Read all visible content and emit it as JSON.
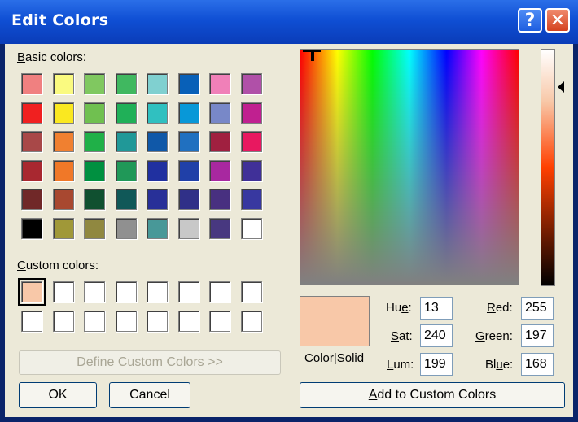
{
  "window": {
    "title": "Edit Colors"
  },
  "basic": {
    "label": "Basic colors:",
    "colors": [
      "#f08080",
      "#fafa80",
      "#80c860",
      "#40b860",
      "#80d0d0",
      "#0860b8",
      "#f080b8",
      "#b050a8",
      "#f02020",
      "#fae820",
      "#70c050",
      "#20b058",
      "#30c0c0",
      "#0898d8",
      "#7888c8",
      "#c02090",
      "#a84848",
      "#f08030",
      "#20b048",
      "#209898",
      "#1058a8",
      "#2070c0",
      "#a02040",
      "#e81860",
      "#a82830",
      "#f07828",
      "#009040",
      "#209858",
      "#2030a0",
      "#2040a8",
      "#a828a0",
      "#403098",
      "#702828",
      "#a84830",
      "#105030",
      "#105858",
      "#283098",
      "#303088",
      "#483080",
      "#3838a0",
      "#000000",
      "#a09838",
      "#908840",
      "#909090",
      "#489898",
      "#c8c8c8",
      "#483880",
      "#ffffff"
    ]
  },
  "custom": {
    "label": "Custom colors:",
    "colors": [
      "#f8c8a8",
      "#ffffff",
      "#ffffff",
      "#ffffff",
      "#ffffff",
      "#ffffff",
      "#ffffff",
      "#ffffff",
      "#ffffff",
      "#ffffff",
      "#ffffff",
      "#ffffff",
      "#ffffff",
      "#ffffff",
      "#ffffff",
      "#ffffff"
    ]
  },
  "define_button": "Define Custom Colors >>",
  "ok_button": "OK",
  "cancel_button": "Cancel",
  "add_button": "Add to Custom Colors",
  "color_solid_label": "Color|Solid",
  "preview_color": "#f8c8a8",
  "fields": {
    "hue": {
      "label": "Hue:",
      "value": "13"
    },
    "sat": {
      "label": "Sat:",
      "value": "240"
    },
    "lum": {
      "label": "Lum:",
      "value": "199"
    },
    "red": {
      "label": "Red:",
      "value": "255"
    },
    "green": {
      "label": "Green:",
      "value": "197"
    },
    "blue": {
      "label": "Blue:",
      "value": "168"
    }
  }
}
